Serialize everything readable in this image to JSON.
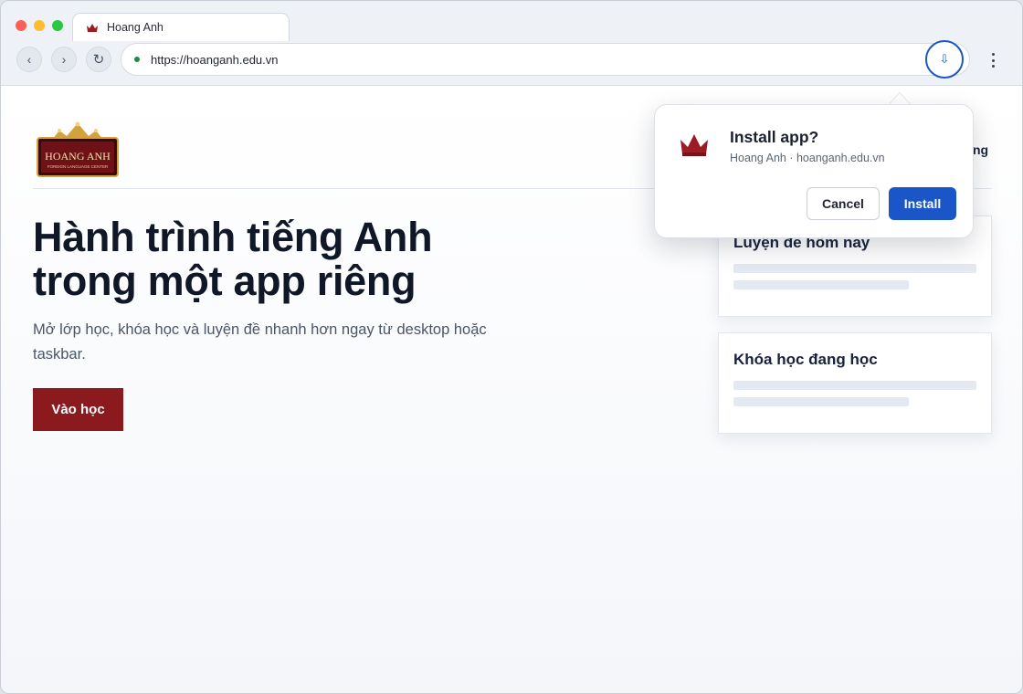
{
  "browser": {
    "tab": {
      "title": "Hoang Anh",
      "icon": "crown-icon"
    },
    "nav": {
      "back_icon": "‹",
      "forward_icon": "›",
      "reload_icon": "↻"
    },
    "address": {
      "url": "https://hoanganh.edu.vn"
    },
    "install_chip_icon": "⇩"
  },
  "page": {
    "logo_text": "HOANG ANH",
    "logo_subtext": "FOREIGN LANGUAGE CENTER",
    "nav_link_partial": "ng",
    "hero": {
      "title_line1": "Hành trình tiếng Anh",
      "title_line2": "trong một app riêng",
      "subtitle": "Mở lớp học, khóa học và luyện đề nhanh hơn ngay từ desktop hoặc taskbar.",
      "cta_label": "Vào học"
    },
    "cards": [
      {
        "title": "Luyện đề hôm nay"
      },
      {
        "title": "Khóa học đang học"
      }
    ]
  },
  "popup": {
    "title": "Install app?",
    "subtitle": "Hoang Anh · hoanganh.edu.vn",
    "cancel_label": "Cancel",
    "install_label": "Install"
  },
  "colors": {
    "brand_red": "#8a1a1e",
    "accent_blue": "#1a56c8",
    "secure_green": "#1e8e3e",
    "logo_gold": "#d4a23a"
  }
}
